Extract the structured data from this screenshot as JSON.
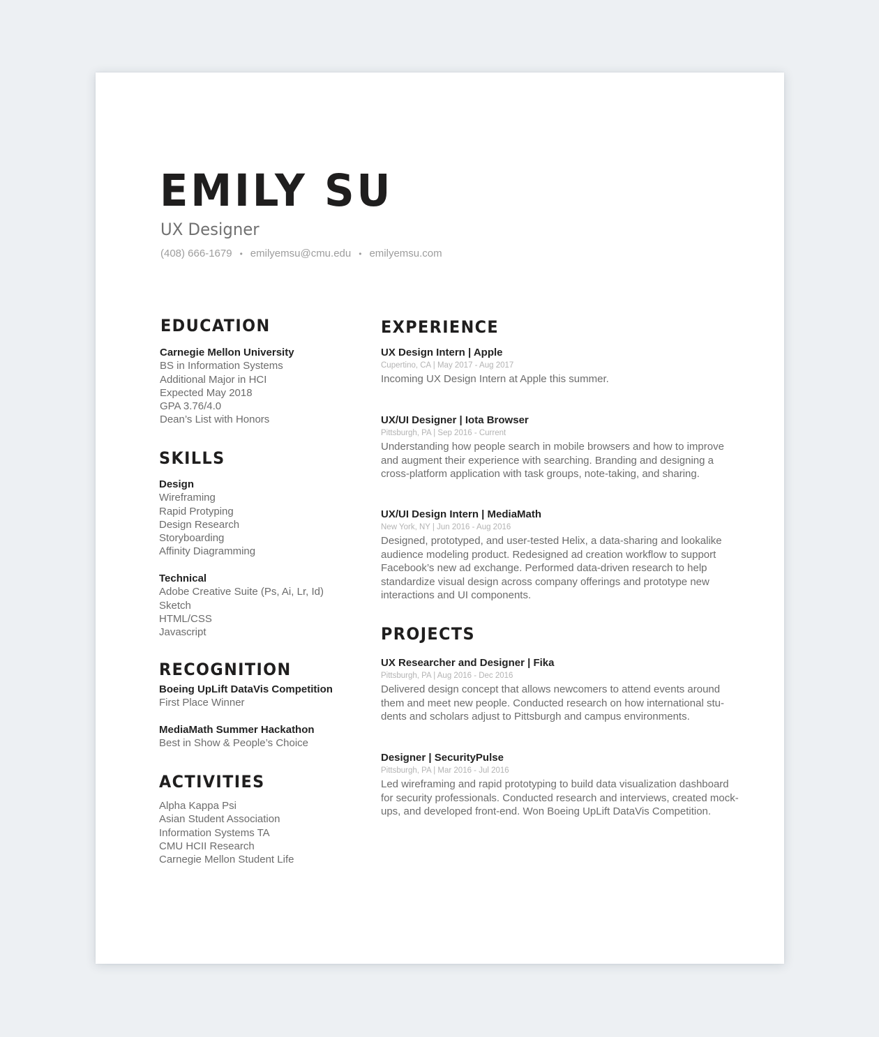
{
  "header": {
    "name": "EMILY SU",
    "role": "UX Designer",
    "contact": {
      "phone": "(408) 666-1679",
      "email": "emilyemsu@cmu.edu",
      "website": "emilyemsu.com",
      "separator": "•"
    }
  },
  "education": {
    "title": "EDUCATION",
    "school": "Carnegie Mellon University",
    "lines": [
      "BS in Information Systems",
      "Additional Major in HCI",
      "Expected May 2018",
      "GPA 3.76/4.0",
      "Dean’s List with Honors"
    ]
  },
  "skills": {
    "title": "SKILLS",
    "groups": [
      {
        "heading": "Design",
        "items": [
          "Wireframing",
          "Rapid Protyping",
          "Design Research",
          "Storyboarding",
          "Affinity Diagramming"
        ]
      },
      {
        "heading": "Technical",
        "items": [
          "Adobe Creative Suite (Ps, Ai, Lr, Id)",
          "Sketch",
          "HTML/CSS",
          "Javascript"
        ]
      }
    ]
  },
  "recognition": {
    "title": "RECOGNITION",
    "items": [
      {
        "name": "Boeing UpLift DataVis Competition",
        "award": "First Place Winner"
      },
      {
        "name": "MediaMath Summer Hackathon",
        "award": "Best in Show & People’s Choice"
      }
    ]
  },
  "activities": {
    "title": "ACTIVITIES",
    "items": [
      "Alpha Kappa Psi",
      "Asian Student Association",
      "Information Systems TA",
      "CMU HCII Research",
      "Carnegie Mellon Student Life"
    ]
  },
  "experience": {
    "title": "EXPERIENCE",
    "items": [
      {
        "title": "UX Design Intern | Apple",
        "meta": "Cupertino,  CA | May 2017 - Aug 2017",
        "lines": [
          "Incoming UX Design Intern at Apple this summer."
        ]
      },
      {
        "title": "UX/UI Designer | Iota Browser",
        "meta": "Pittsburgh, PA |  Sep 2016 - Current",
        "lines": [
          "Understanding how people search in mobile browsers and how to improve",
          "and augment their experience with searching. Branding and designing a",
          "cross-platform application with task groups, note-taking, and sharing."
        ]
      },
      {
        "title": "UX/UI Design Intern | MediaMath",
        "meta": "New York, NY | Jun 2016 - Aug 2016",
        "lines": [
          "Designed, prototyped, and user-tested Helix, a data-sharing and lookalike",
          "audience modeling product. Redesigned ad creation workflow to support",
          "Facebook’s new ad exchange. Performed data-driven research to help",
          "standardize visual design across company offerings and prototype new",
          "interactions and UI components."
        ]
      }
    ]
  },
  "projects": {
    "title": "PROJECTS",
    "items": [
      {
        "title": "UX Researcher and Designer | Fika",
        "meta": "Pittsburgh, PA | Aug 2016 - Dec 2016",
        "lines": [
          "Delivered design concept that allows newcomers to attend events around",
          "them and meet new people. Conducted research on how international stu-",
          "dents and scholars adjust to Pittsburgh and campus environments."
        ]
      },
      {
        "title": "Designer | SecurityPulse",
        "meta": "Pittsburgh, PA | Mar 2016 - Jul 2016",
        "lines": [
          "Led wireframing and rapid prototyping to build data visualization dashboard",
          "for security professionals. Conducted research and interviews, created mock-",
          "ups, and developed front-end. Won Boeing UpLift DataVis Competition."
        ]
      }
    ]
  }
}
